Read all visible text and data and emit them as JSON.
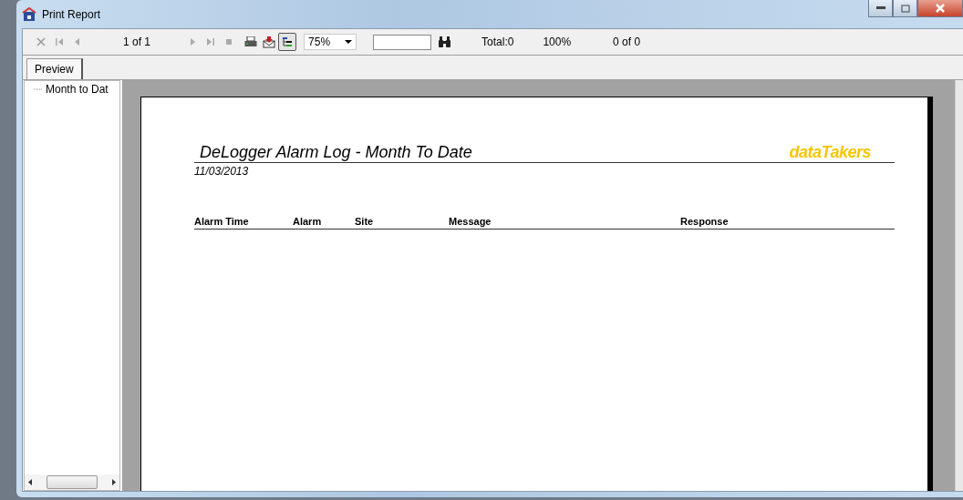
{
  "window": {
    "title": "Print Report"
  },
  "toolbar": {
    "page_status": "1 of 1",
    "tree_toggle": {
      "pressed": true
    },
    "zoom": {
      "value": "75%"
    },
    "total": "Total:0",
    "percent": "100%",
    "matches": "0 of 0"
  },
  "tabs": [
    {
      "label": "Preview",
      "selected": true
    }
  ],
  "tree": {
    "items": [
      {
        "label": "Month to Dat"
      }
    ]
  },
  "report": {
    "title": "DeLogger Alarm Log - Month To Date",
    "logo": "dataTakers",
    "date": "11/03/2013",
    "columns": [
      "Alarm Time",
      "Alarm",
      "Site",
      "Message",
      "Response"
    ]
  }
}
